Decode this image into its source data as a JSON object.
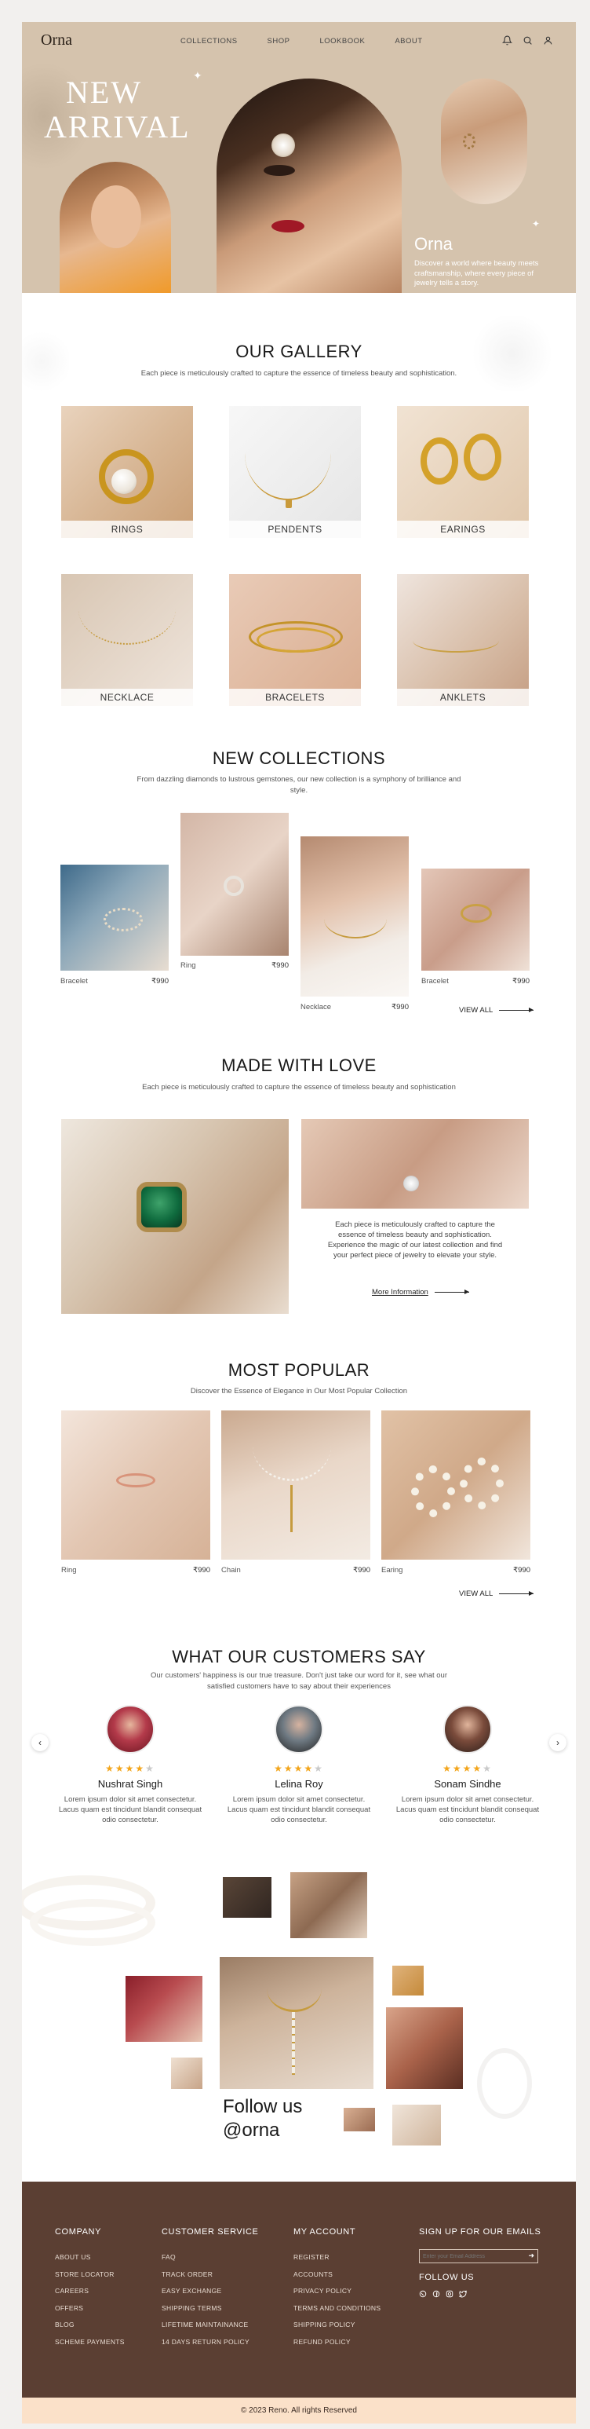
{
  "brand": "Orna",
  "nav": {
    "items": [
      {
        "label": "COLLECTIONS"
      },
      {
        "label": "SHOP"
      },
      {
        "label": "LOOKBOOK"
      },
      {
        "label": "ABOUT"
      }
    ]
  },
  "hero": {
    "headline_line1": "NEW",
    "headline_line2": "ARRIVAL",
    "brand": "Orna",
    "tagline": "Discover a world where beauty meets craftsmanship, where every piece of jewelry tells a story."
  },
  "gallery": {
    "title": "OUR GALLERY",
    "subtitle": "Each piece is meticulously crafted to capture the essence of timeless beauty and sophistication.",
    "items": [
      {
        "label": "RINGS"
      },
      {
        "label": "PENDENTS"
      },
      {
        "label": "EARINGS"
      },
      {
        "label": "NECKLACE"
      },
      {
        "label": "BRACELETS"
      },
      {
        "label": "ANKLETS"
      }
    ]
  },
  "collections": {
    "title": "NEW COLLECTIONS",
    "subtitle": "From dazzling diamonds to lustrous gemstones, our new collection is a symphony of brilliance and style.",
    "items": [
      {
        "name": "Bracelet",
        "price": "₹990"
      },
      {
        "name": "Ring",
        "price": "₹990"
      },
      {
        "name": "Necklace",
        "price": "₹990"
      },
      {
        "name": "Bracelet",
        "price": "₹990"
      }
    ],
    "view_all": "VIEW ALL"
  },
  "love": {
    "title": "MADE WITH LOVE",
    "subtitle": "Each piece is meticulously crafted to capture the essence of timeless beauty and sophistication",
    "body": "Each piece is meticulously crafted to capture the essence of timeless beauty and sophistication. Experience the magic of our latest collection and find your perfect piece of jewelry to elevate your style.",
    "link": "More Information"
  },
  "popular": {
    "title": "MOST POPULAR",
    "subtitle": "Discover the Essence of Elegance in Our Most Popular Collection",
    "items": [
      {
        "name": "Ring",
        "price": "₹990"
      },
      {
        "name": "Chain",
        "price": "₹990"
      },
      {
        "name": "Earing",
        "price": "₹990"
      }
    ],
    "view_all": "VIEW ALL"
  },
  "testimonials": {
    "title": "WHAT OUR CUSTOMERS SAY",
    "subtitle": "Our customers' happiness is our true treasure. Don't just take our word for it, see what our satisfied customers have to say about their experiences",
    "items": [
      {
        "name": "Nushrat Singh",
        "rating": 4,
        "text": "Lorem ipsum dolor sit amet consectetur. Lacus quam est tincidunt blandit consequat odio consectetur."
      },
      {
        "name": "Lelina Roy",
        "rating": 4,
        "text": "Lorem ipsum dolor sit amet consectetur. Lacus quam est tincidunt blandit consequat odio consectetur."
      },
      {
        "name": "Sonam Sindhe",
        "rating": 4,
        "text": "Lorem ipsum dolor sit amet consectetur. Lacus quam est tincidunt blandit consequat odio consectetur."
      }
    ],
    "prev_icon": "chevron-left-icon",
    "next_icon": "chevron-right-icon"
  },
  "follow": {
    "line1": "Follow us",
    "line2": "@orna"
  },
  "footer": {
    "company": {
      "title": "COMPANY",
      "links": [
        "ABOUT US",
        "STORE LOCATOR",
        "CAREERS",
        "OFFERS",
        "BLOG",
        "SCHEME PAYMENTS"
      ]
    },
    "service": {
      "title": "CUSTOMER SERVICE",
      "links": [
        "FAQ",
        "TRACK ORDER",
        "EASY EXCHANGE",
        "SHIPPING TERMS",
        "LIFETIME MAINTAINANCE",
        "14 DAYS RETURN POLICY"
      ]
    },
    "account": {
      "title": "MY ACCOUNT",
      "links": [
        "REGISTER",
        "ACCOUNTS",
        "PRIVACY POLICY",
        "TERMS AND CONDITIONS",
        "SHIPPING POLICY",
        "REFUND POLICY"
      ]
    },
    "newsletter": {
      "title": "SIGN UP FOR OUR EMAILS",
      "placeholder": "Enter your Email Address",
      "button": "➜",
      "follow_title": "FOLLOW US"
    },
    "social_icons": [
      "whatsapp-icon",
      "facebook-icon",
      "instagram-icon",
      "twitter-icon"
    ],
    "copyright": "© 2023 Reno. All rights Reserved"
  },
  "colors": {
    "hero_bg": "#d5c3ad",
    "footer_bg": "#5b3f33",
    "copyright_bg": "#fbe1c9",
    "star": "#f3a51b"
  }
}
